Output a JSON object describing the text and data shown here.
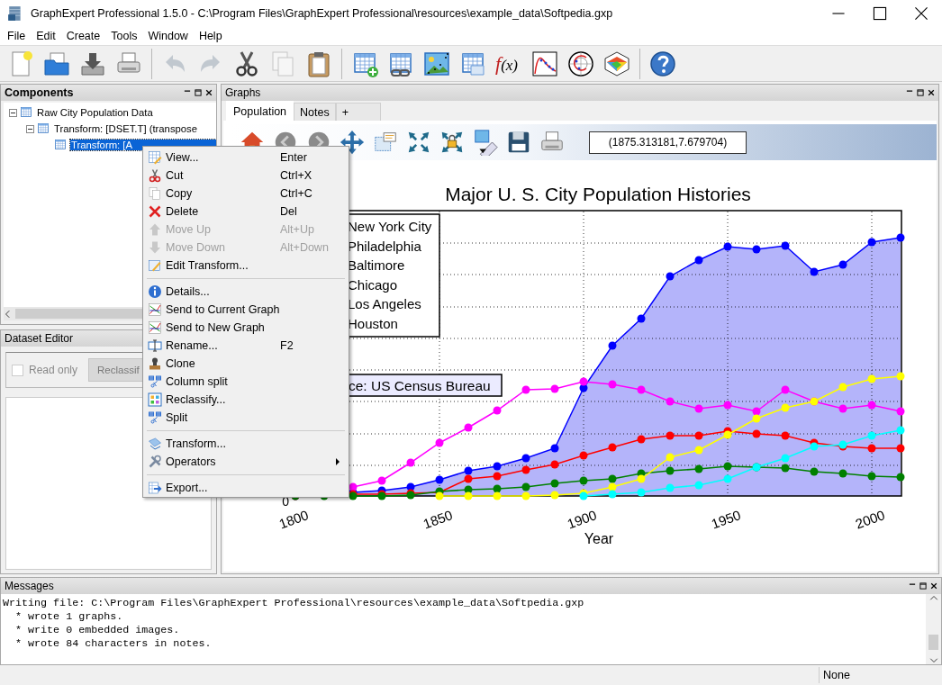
{
  "window": {
    "title": "GraphExpert Professional 1.5.0 - C:\\Program Files\\GraphExpert Professional\\resources\\example_data\\Softpedia.gxp"
  },
  "menu_bar": [
    "File",
    "Edit",
    "Create",
    "Tools",
    "Window",
    "Help"
  ],
  "toolbar": [
    {
      "kind": "new"
    },
    {
      "kind": "open"
    },
    {
      "kind": "save"
    },
    {
      "kind": "print"
    },
    {
      "kind": "separator"
    },
    {
      "kind": "undo",
      "disabled": true
    },
    {
      "kind": "redo",
      "disabled": true
    },
    {
      "kind": "cut"
    },
    {
      "kind": "copy",
      "disabled": true
    },
    {
      "kind": "paste"
    },
    {
      "kind": "separator"
    },
    {
      "kind": "new_dataset"
    },
    {
      "kind": "linked_dataset"
    },
    {
      "kind": "graph"
    },
    {
      "kind": "notes"
    },
    {
      "kind": "function",
      "label": "f(x)"
    },
    {
      "kind": "curve_fit"
    },
    {
      "kind": "polar"
    },
    {
      "kind": "surface"
    },
    {
      "kind": "separator"
    },
    {
      "kind": "help"
    }
  ],
  "components": {
    "title": "Components",
    "focused": true,
    "tree": [
      {
        "label": "Raw City Population Data",
        "expanded": true,
        "selected": false,
        "children": [
          {
            "label": "Transform: [DSET.T] (transpose",
            "expanded": true,
            "selected": false,
            "children": [
              {
                "label": "Transform: [A",
                "selected": true
              }
            ]
          }
        ]
      }
    ]
  },
  "dataset_editor": {
    "title": "Dataset Editor",
    "focused": false,
    "read_only": {
      "label": "Read only",
      "checked": false,
      "disabled": true
    },
    "reclassify_button": {
      "label": "Reclassif",
      "disabled": true
    }
  },
  "graphs": {
    "title": "Graphs",
    "focused": false,
    "tabs": [
      {
        "label": "Population",
        "selected": true
      },
      {
        "label": "Notes",
        "selected": false
      },
      {
        "label": "+",
        "selected": false
      }
    ],
    "toolbar": [
      {
        "kind": "home"
      },
      {
        "kind": "back"
      },
      {
        "kind": "forward"
      },
      {
        "kind": "pan"
      },
      {
        "kind": "zoom_box"
      },
      {
        "kind": "fit"
      },
      {
        "kind": "lock_fit"
      },
      {
        "kind": "image_tag"
      },
      {
        "kind": "save"
      },
      {
        "kind": "print"
      }
    ],
    "coordinates": "(1875.313181,7.679704)",
    "plot": {
      "title": "Major U. S. City Population Histories",
      "legend": [
        "New York City",
        "Philadelphia",
        "Baltimore",
        "Chicago",
        "Los Angeles",
        "Houston"
      ],
      "annotation": "ce: US Census Bureau",
      "xticks": [
        "1800",
        "1850",
        "1900",
        "1950",
        "2000"
      ],
      "ytick": "0",
      "xlabel": "Year"
    }
  },
  "context_menu": {
    "groups": [
      [
        {
          "kind": "view",
          "label": "View...",
          "shortcut": "Enter",
          "disabled": false
        },
        {
          "kind": "cut",
          "label": "Cut",
          "shortcut": "Ctrl+X",
          "disabled": false
        },
        {
          "kind": "copy",
          "label": "Copy",
          "shortcut": "Ctrl+C",
          "disabled": false
        },
        {
          "kind": "delete",
          "label": "Delete",
          "shortcut": "Del",
          "disabled": false
        },
        {
          "kind": "up",
          "label": "Move Up",
          "shortcut": "Alt+Up",
          "disabled": true
        },
        {
          "kind": "down",
          "label": "Move Down",
          "shortcut": "Alt+Down",
          "disabled": true
        },
        {
          "kind": "edit",
          "label": "Edit Transform...",
          "disabled": false
        }
      ],
      [
        {
          "kind": "info",
          "label": "Details...",
          "disabled": false
        },
        {
          "kind": "send",
          "label": "Send to Current Graph",
          "disabled": false
        },
        {
          "kind": "send",
          "label": "Send to New Graph",
          "disabled": false
        },
        {
          "kind": "rename",
          "label": "Rename...",
          "shortcut": "F2",
          "disabled": false
        },
        {
          "kind": "clone",
          "label": "Clone",
          "disabled": false
        },
        {
          "kind": "split",
          "label": "Column split",
          "disabled": false
        },
        {
          "kind": "reclassify",
          "label": "Reclassify...",
          "disabled": false
        },
        {
          "kind": "split",
          "label": "Split",
          "disabled": false
        }
      ],
      [
        {
          "kind": "transform",
          "label": "Transform...",
          "disabled": false
        },
        {
          "kind": "tools",
          "label": "Operators",
          "disabled": false,
          "submenu": true
        }
      ],
      [
        {
          "kind": "export",
          "label": "Export...",
          "disabled": false
        }
      ]
    ]
  },
  "messages": {
    "title": "Messages",
    "lines": [
      "Writing file: C:\\Program Files\\GraphExpert Professional\\resources\\example_data\\Softpedia.gxp",
      "  * wrote 1 graphs.",
      "  * write 0 embedded images.",
      "  * wrote 84 characters in notes."
    ]
  },
  "status_bar": {
    "text": "None"
  }
}
